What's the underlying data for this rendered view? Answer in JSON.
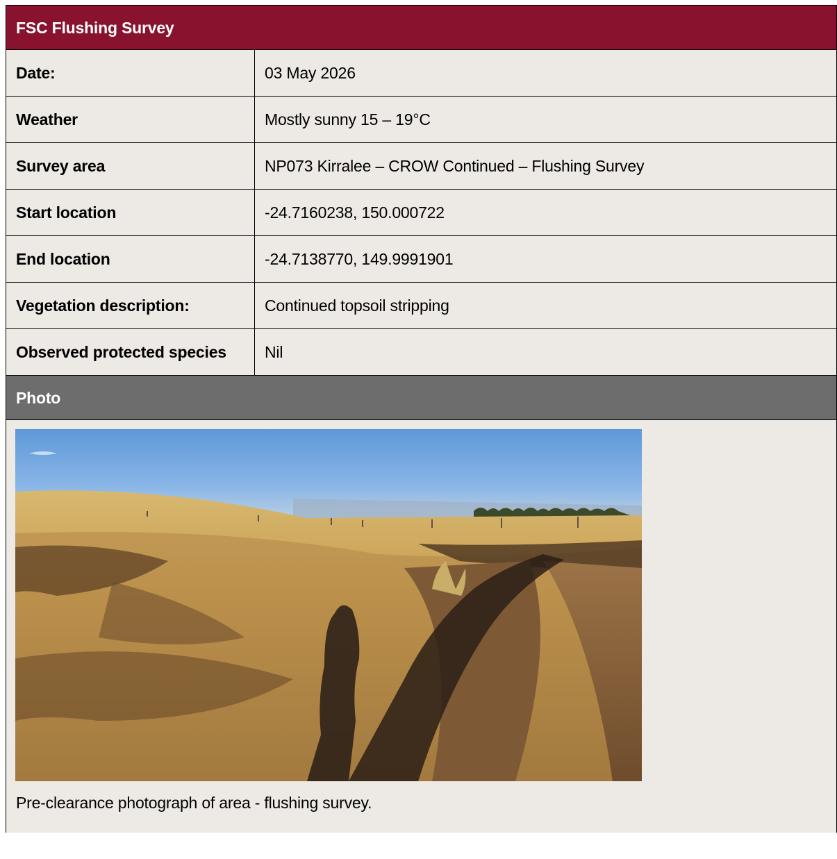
{
  "header": {
    "title": "FSC Flushing Survey"
  },
  "rows": [
    {
      "label": "Date:",
      "value": "03 May 2026"
    },
    {
      "label": "Weather",
      "value": "Mostly sunny 15 – 19°C"
    },
    {
      "label": "Survey area",
      "value": "NP073 Kirralee – CROW Continued – Flushing Survey"
    },
    {
      "label": "Start location",
      "value": "-24.7160238, 150.000722"
    },
    {
      "label": "End location",
      "value": "-24.7138770, 149.9991901"
    },
    {
      "label": "Vegetation description:",
      "value": "Continued topsoil stripping"
    },
    {
      "label": "Observed protected species",
      "value": "Nil"
    }
  ],
  "photo_section": {
    "heading": "Photo",
    "caption": "Pre-clearance photograph of area - flushing survey."
  },
  "colors": {
    "header_bg": "#89132e",
    "photo_bar_bg": "#6d6d6d",
    "body_bg": "#ede9e4"
  }
}
